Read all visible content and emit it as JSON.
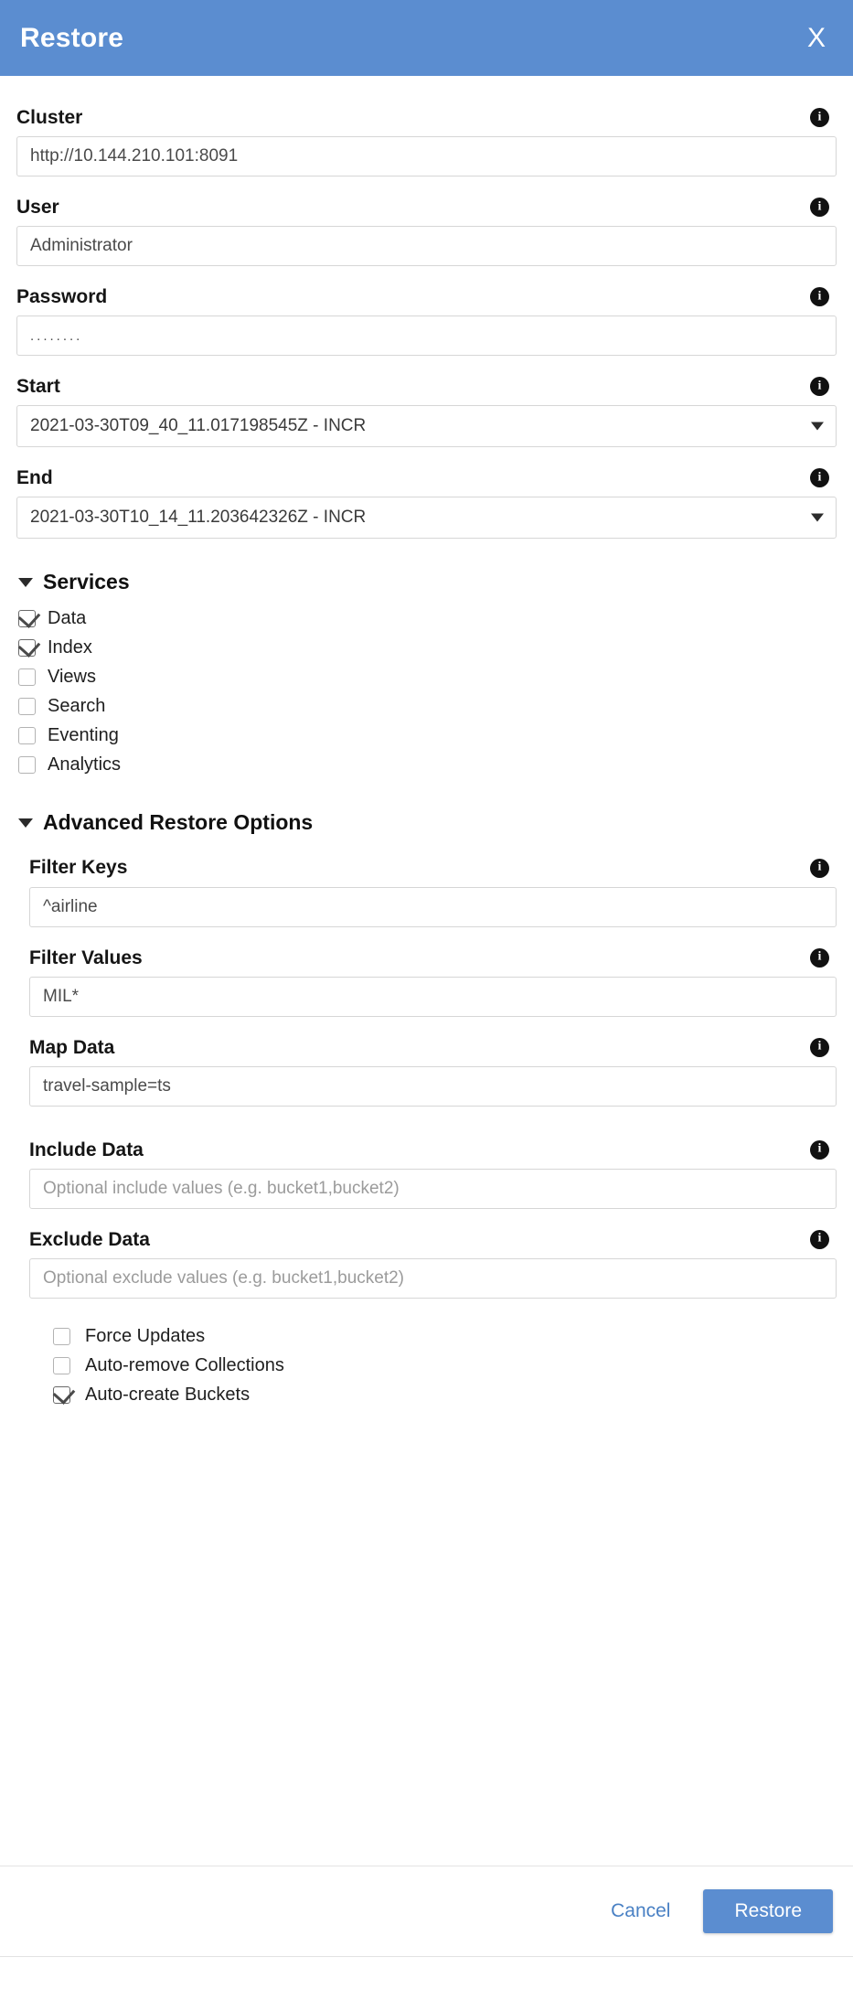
{
  "header": {
    "title": "Restore",
    "close_label": "X",
    "background_color": "#5b8dd0"
  },
  "info_icon_glyph": "i",
  "fields": {
    "cluster": {
      "label": "Cluster",
      "value": "http://10.144.210.101:8091"
    },
    "user": {
      "label": "User",
      "value": "Administrator"
    },
    "password": {
      "label": "Password",
      "value": "........",
      "masked_length": 8
    },
    "start": {
      "label": "Start",
      "value": "2021-03-30T09_40_11.017198545Z - INCR"
    },
    "end": {
      "label": "End",
      "value": "2021-03-30T10_14_11.203642326Z - INCR"
    }
  },
  "services": {
    "title": "Services",
    "items": [
      {
        "label": "Data",
        "checked": true
      },
      {
        "label": "Index",
        "checked": true
      },
      {
        "label": "Views",
        "checked": false
      },
      {
        "label": "Search",
        "checked": false
      },
      {
        "label": "Eventing",
        "checked": false
      },
      {
        "label": "Analytics",
        "checked": false
      }
    ]
  },
  "advanced": {
    "title": "Advanced Restore Options",
    "fields": {
      "filter_keys": {
        "label": "Filter Keys",
        "value": "^airline",
        "placeholder": ""
      },
      "filter_values": {
        "label": "Filter Values",
        "value": "MIL*",
        "placeholder": ""
      },
      "map_data": {
        "label": "Map Data",
        "value": "travel-sample=ts",
        "placeholder": ""
      },
      "include_data": {
        "label": "Include Data",
        "value": "",
        "placeholder": "Optional include values (e.g. bucket1,bucket2)"
      },
      "exclude_data": {
        "label": "Exclude Data",
        "value": "",
        "placeholder": "Optional exclude values (e.g. bucket1,bucket2)"
      }
    },
    "options": [
      {
        "label": "Force Updates",
        "checked": false
      },
      {
        "label": "Auto-remove Collections",
        "checked": false
      },
      {
        "label": "Auto-create Buckets",
        "checked": true
      }
    ]
  },
  "footer": {
    "cancel_label": "Cancel",
    "restore_label": "Restore",
    "primary_color": "#5b8dd0",
    "link_color": "#4a81c4"
  }
}
